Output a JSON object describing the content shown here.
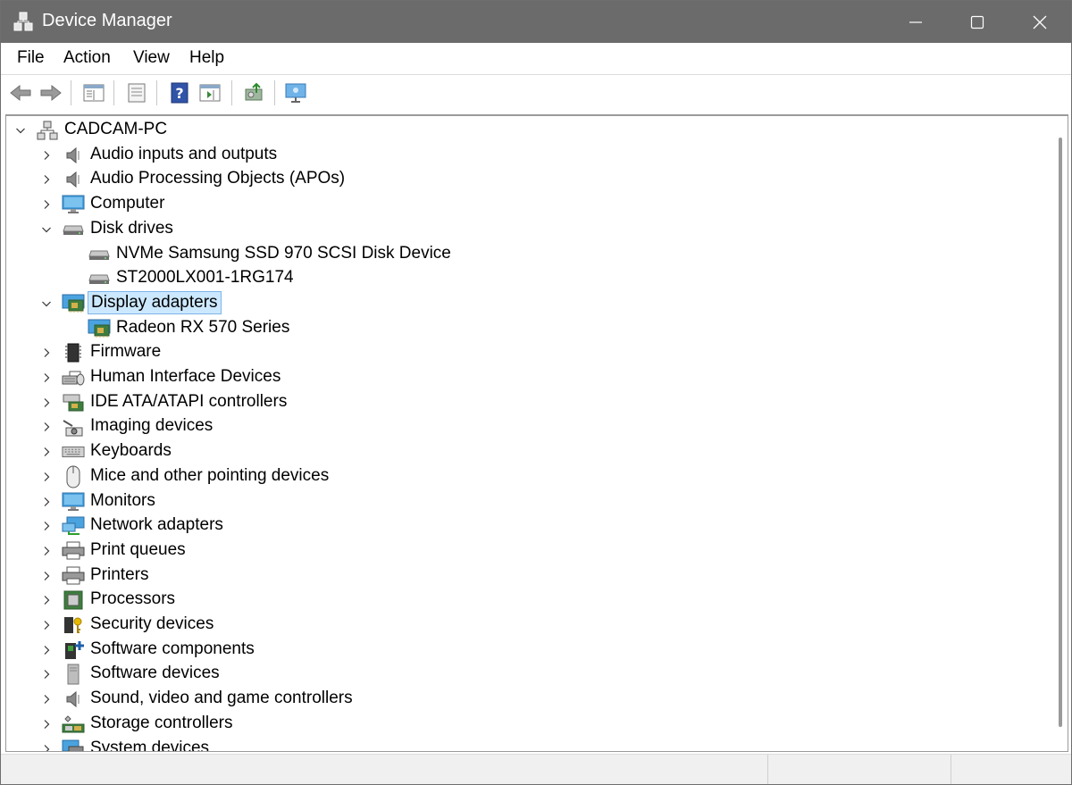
{
  "window": {
    "title": "Device Manager"
  },
  "menu": [
    "File",
    "Action",
    "View",
    "Help"
  ],
  "toolbar": [
    "back-icon",
    "forward-icon",
    "show-hide-tree-icon",
    "properties-icon",
    "help-icon",
    "action-pane-icon",
    "update-driver-icon",
    "scan-hardware-icon"
  ],
  "tree": {
    "root": "CADCAM-PC",
    "items": [
      {
        "label": "Audio inputs and outputs",
        "icon": "speaker-icon",
        "expanded": false
      },
      {
        "label": "Audio Processing Objects (APOs)",
        "icon": "speaker-icon",
        "expanded": false
      },
      {
        "label": "Computer",
        "icon": "computer-icon",
        "expanded": false
      },
      {
        "label": "Disk drives",
        "icon": "disk-drive-icon",
        "expanded": true,
        "children": [
          {
            "label": "NVMe Samsung SSD 970 SCSI Disk Device",
            "icon": "disk-drive-icon"
          },
          {
            "label": "ST2000LX001-1RG174",
            "icon": "disk-drive-icon"
          }
        ]
      },
      {
        "label": "Display adapters",
        "icon": "display-adapter-icon",
        "expanded": true,
        "selected": true,
        "children": [
          {
            "label": "Radeon RX 570 Series",
            "icon": "display-adapter-icon"
          }
        ]
      },
      {
        "label": "Firmware",
        "icon": "firmware-icon",
        "expanded": false
      },
      {
        "label": "Human Interface Devices",
        "icon": "hid-icon",
        "expanded": false
      },
      {
        "label": "IDE ATA/ATAPI controllers",
        "icon": "ide-controller-icon",
        "expanded": false
      },
      {
        "label": "Imaging devices",
        "icon": "camera-icon",
        "expanded": false
      },
      {
        "label": "Keyboards",
        "icon": "keyboard-icon",
        "expanded": false
      },
      {
        "label": "Mice and other pointing devices",
        "icon": "mouse-icon",
        "expanded": false
      },
      {
        "label": "Monitors",
        "icon": "monitor-icon",
        "expanded": false
      },
      {
        "label": "Network adapters",
        "icon": "network-adapter-icon",
        "expanded": false
      },
      {
        "label": "Print queues",
        "icon": "printer-icon",
        "expanded": false
      },
      {
        "label": "Printers",
        "icon": "printer-icon",
        "expanded": false
      },
      {
        "label": "Processors",
        "icon": "processor-icon",
        "expanded": false
      },
      {
        "label": "Security devices",
        "icon": "security-key-icon",
        "expanded": false
      },
      {
        "label": "Software components",
        "icon": "software-component-icon",
        "expanded": false
      },
      {
        "label": "Software devices",
        "icon": "software-device-icon",
        "expanded": false
      },
      {
        "label": "Sound, video and game controllers",
        "icon": "speaker-icon",
        "expanded": false
      },
      {
        "label": "Storage controllers",
        "icon": "storage-controller-icon",
        "expanded": false
      },
      {
        "label": "System devices",
        "icon": "system-device-icon",
        "expanded": false
      }
    ]
  },
  "colors": {
    "titlebar": "#6b6b6b",
    "selection": "#cce8ff",
    "selection_border": "#7eb4ea"
  }
}
